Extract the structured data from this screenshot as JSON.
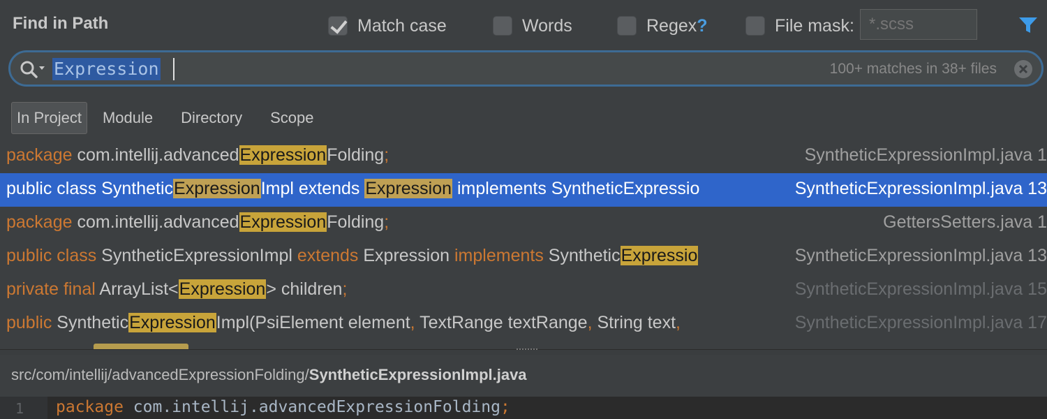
{
  "header": {
    "title": "Find in Path",
    "options": {
      "match_case": "Match case",
      "words": "Words",
      "regex": "Regex",
      "regex_help": "?",
      "file_mask": "File mask:"
    },
    "mask_placeholder": "*.scss"
  },
  "search": {
    "query": "Expression",
    "match_count": "100+ matches in 38+ files"
  },
  "scopes": [
    "In Project",
    "Module",
    "Directory",
    "Scope"
  ],
  "results": [
    {
      "parts": [
        [
          "kw",
          "package "
        ],
        [
          "t",
          "com.intellij.advanced"
        ],
        [
          "hl",
          "Expression"
        ],
        [
          "t",
          "Folding"
        ],
        [
          "p",
          ";"
        ]
      ],
      "file": "SyntheticExpressionImpl.java 1",
      "selected": false,
      "dim": false
    },
    {
      "parts": [
        [
          "kw",
          "public class "
        ],
        [
          "t",
          "Synthetic"
        ],
        [
          "hl",
          "Expression"
        ],
        [
          "t",
          "Impl extends "
        ],
        [
          "hl",
          "Expression"
        ],
        [
          "t",
          " implements SyntheticExpressio"
        ]
      ],
      "file": "SyntheticExpressionImpl.java 13",
      "selected": true,
      "dim": false
    },
    {
      "parts": [
        [
          "kw",
          "package "
        ],
        [
          "t",
          "com.intellij.advanced"
        ],
        [
          "hl",
          "Expression"
        ],
        [
          "t",
          "Folding"
        ],
        [
          "p",
          ";"
        ]
      ],
      "file": "GettersSetters.java 1",
      "selected": false,
      "dim": false
    },
    {
      "parts": [
        [
          "kw",
          "public class "
        ],
        [
          "t",
          "SyntheticExpressionImpl "
        ],
        [
          "kw",
          "extends "
        ],
        [
          "t",
          "Expression "
        ],
        [
          "kw",
          "implements "
        ],
        [
          "t",
          "Synthetic"
        ],
        [
          "hl",
          "Expressio"
        ]
      ],
      "file": "SyntheticExpressionImpl.java 13",
      "selected": false,
      "dim": false
    },
    {
      "parts": [
        [
          "kw",
          "private final "
        ],
        [
          "t",
          "ArrayList<"
        ],
        [
          "hl",
          "Expression"
        ],
        [
          "t",
          "> children"
        ],
        [
          "p",
          ";"
        ]
      ],
      "file": "SyntheticExpressionImpl.java 15",
      "selected": false,
      "dim": true
    },
    {
      "parts": [
        [
          "kw",
          "public "
        ],
        [
          "t",
          "Synthetic"
        ],
        [
          "hl",
          "Expression"
        ],
        [
          "t",
          "Impl(PsiElement element"
        ],
        [
          "p",
          ", "
        ],
        [
          "t",
          "TextRange textRange"
        ],
        [
          "p",
          ", "
        ],
        [
          "t",
          "String text"
        ],
        [
          "p",
          ","
        ]
      ],
      "file": "SyntheticExpressionImpl.java 17",
      "selected": false,
      "dim": true
    }
  ],
  "preview": {
    "path_prefix": "src/com/intellij/advancedExpressionFolding/",
    "file_name": "SyntheticExpressionImpl.java",
    "line_number": "1",
    "line_keyword": "package",
    "line_rest": " com.intellij.advancedExpressionFolding",
    "line_punc": ";"
  },
  "colors": {
    "background": "#3c3f41",
    "selection": "#2f65ca",
    "highlight": "#c8a43a",
    "keyword": "#cc7832",
    "accent": "#4a9de0"
  },
  "icons": {
    "search": "search-icon",
    "clear": "clear-icon",
    "filter": "filter-icon"
  }
}
